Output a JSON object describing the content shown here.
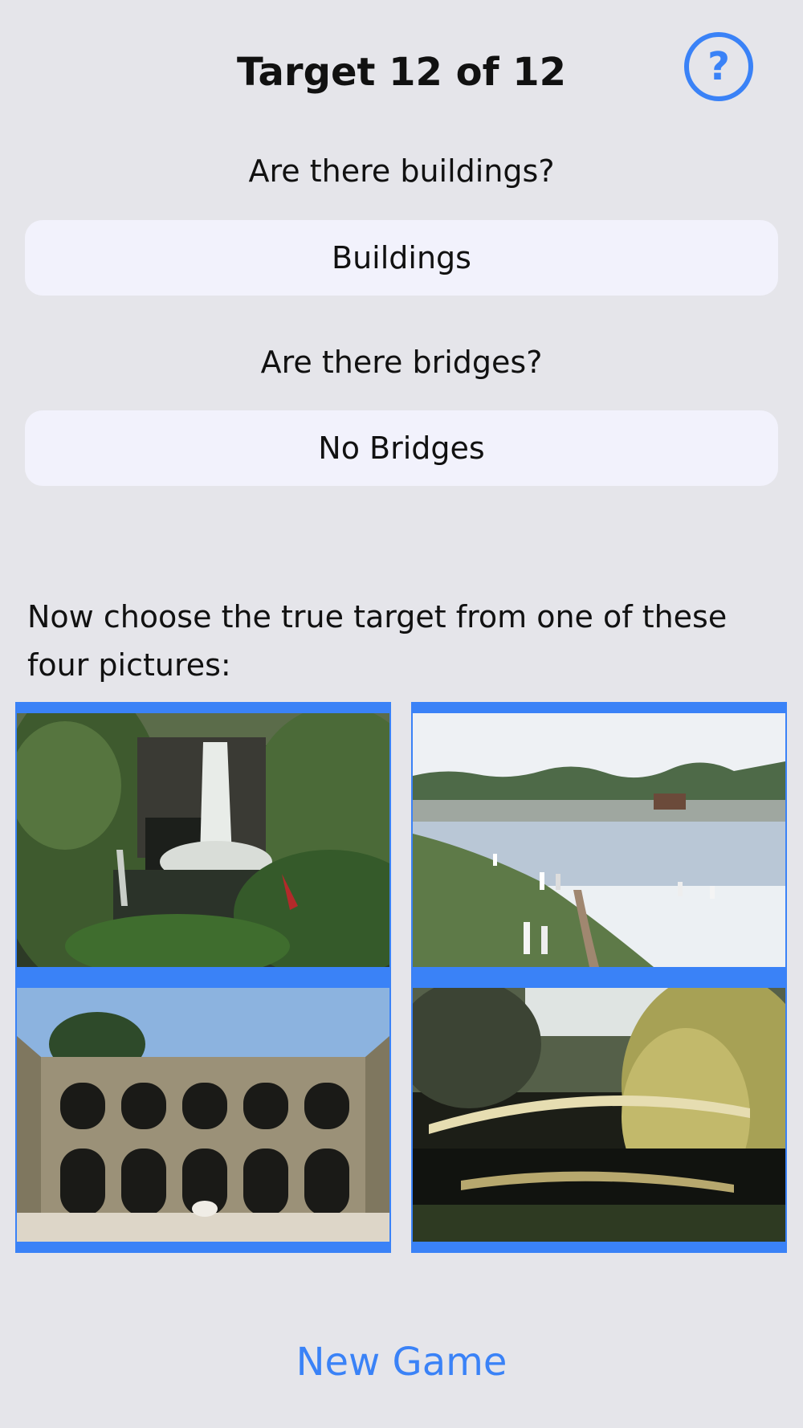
{
  "header": {
    "title": "Target 12 of 12",
    "help_glyph": "?"
  },
  "questions": [
    {
      "text": "Are there buildings?",
      "answer": "Buildings"
    },
    {
      "text": "Are there bridges?",
      "answer": "No Bridges"
    }
  ],
  "prompt": "Now choose the true target from one of these four pictures:",
  "pictures": [
    {
      "subject": "waterfall"
    },
    {
      "subject": "river with people"
    },
    {
      "subject": "arched stone courtyard"
    },
    {
      "subject": "arched bridge with willow"
    }
  ],
  "footer": {
    "new_game_label": "New Game"
  },
  "colors": {
    "accent": "#3a82f7",
    "background": "#e5e5ea",
    "answer_button": "#f2f2fc"
  }
}
